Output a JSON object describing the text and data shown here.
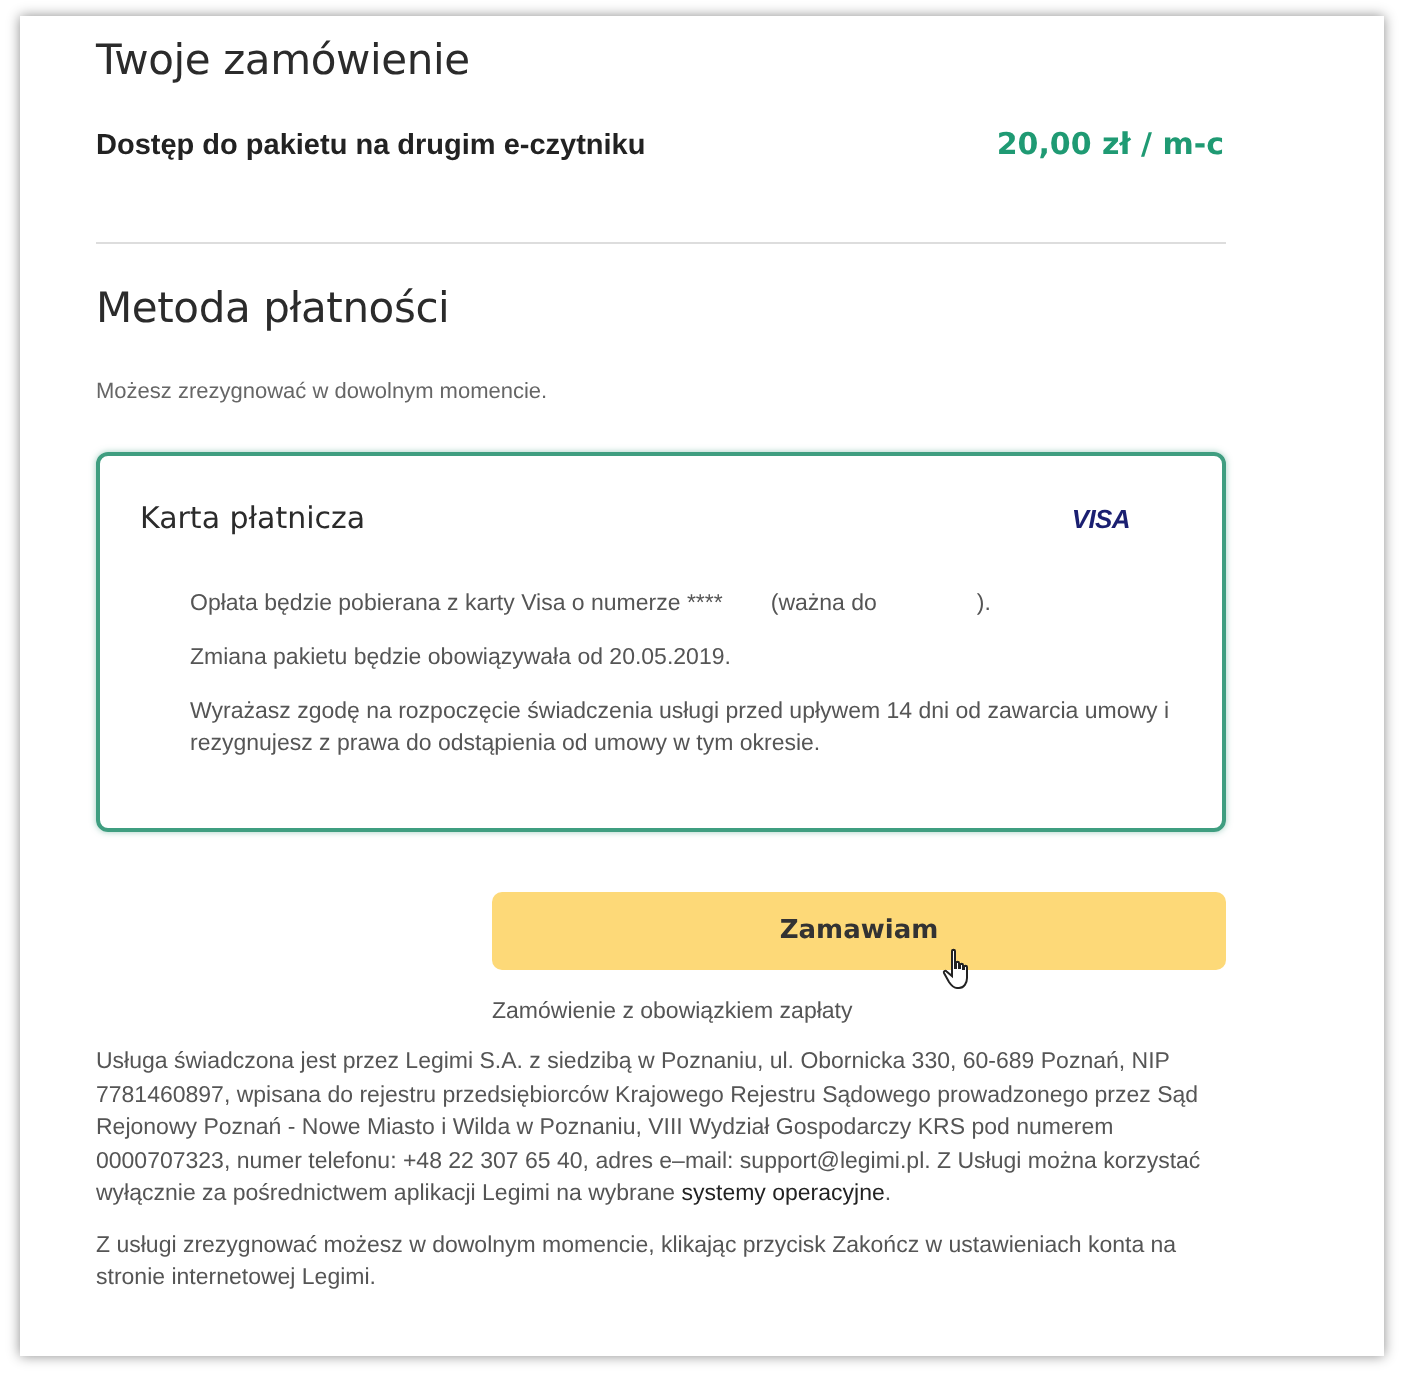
{
  "order": {
    "title": "Twoje zamówienie",
    "item": "Dostęp do pakietu na drugim e-czytniku",
    "price": "20,00 zł / m-c"
  },
  "payment": {
    "title": "Metoda płatności",
    "note": "Możesz zrezygnować w dowolnym momencie.",
    "card": {
      "title": "Karta płatnicza",
      "brand": "VISA",
      "selected": true,
      "charge_text": "Opłata będzie pobierana z karty Visa o numerze ****",
      "validity_open": "(ważna do",
      "validity_close": ").",
      "lines": [
        "Zmiana pakietu będzie obowiązywała od 20.05.2019.",
        "Wyrażasz zgodę na rozpoczęcie świadczenia usługi przed upływem 14 dni od zawarcia umowy i rezygnujesz z prawa do odstąpienia od umowy w tym okresie."
      ]
    }
  },
  "submit": {
    "label": "Zamawiam",
    "caption": "Zamówienie z obowiązkiem zapłaty"
  },
  "legal": {
    "text_before": "Usługa świadczona jest przez Legimi S.A. z siedzibą w Poznaniu, ul. Obornicka 330, 60-689 Poznań, NIP 7781460897, wpisana do rejestru przedsiębiorców Krajowego Rejestru Sądowego prowadzonego przez Sąd Rejonowy Poznań - Nowe Miasto i Wilda w Poznaniu, VIII Wydział Gospodarczy KRS pod numerem 0000707323, numer telefonu: +48 22 307 65 40, adres e–mail: support@legimi.pl. Z Usługi można korzystać wyłącznie za pośrednictwem aplikacji Legimi na wybrane",
    "link": "systemy operacyjne",
    "text_after": ".",
    "cancel": "Z usługi zrezygnować możesz w dowolnym momencie, klikając przycisk Zakończ w ustawieniach konta na stronie internetowej Legimi."
  }
}
